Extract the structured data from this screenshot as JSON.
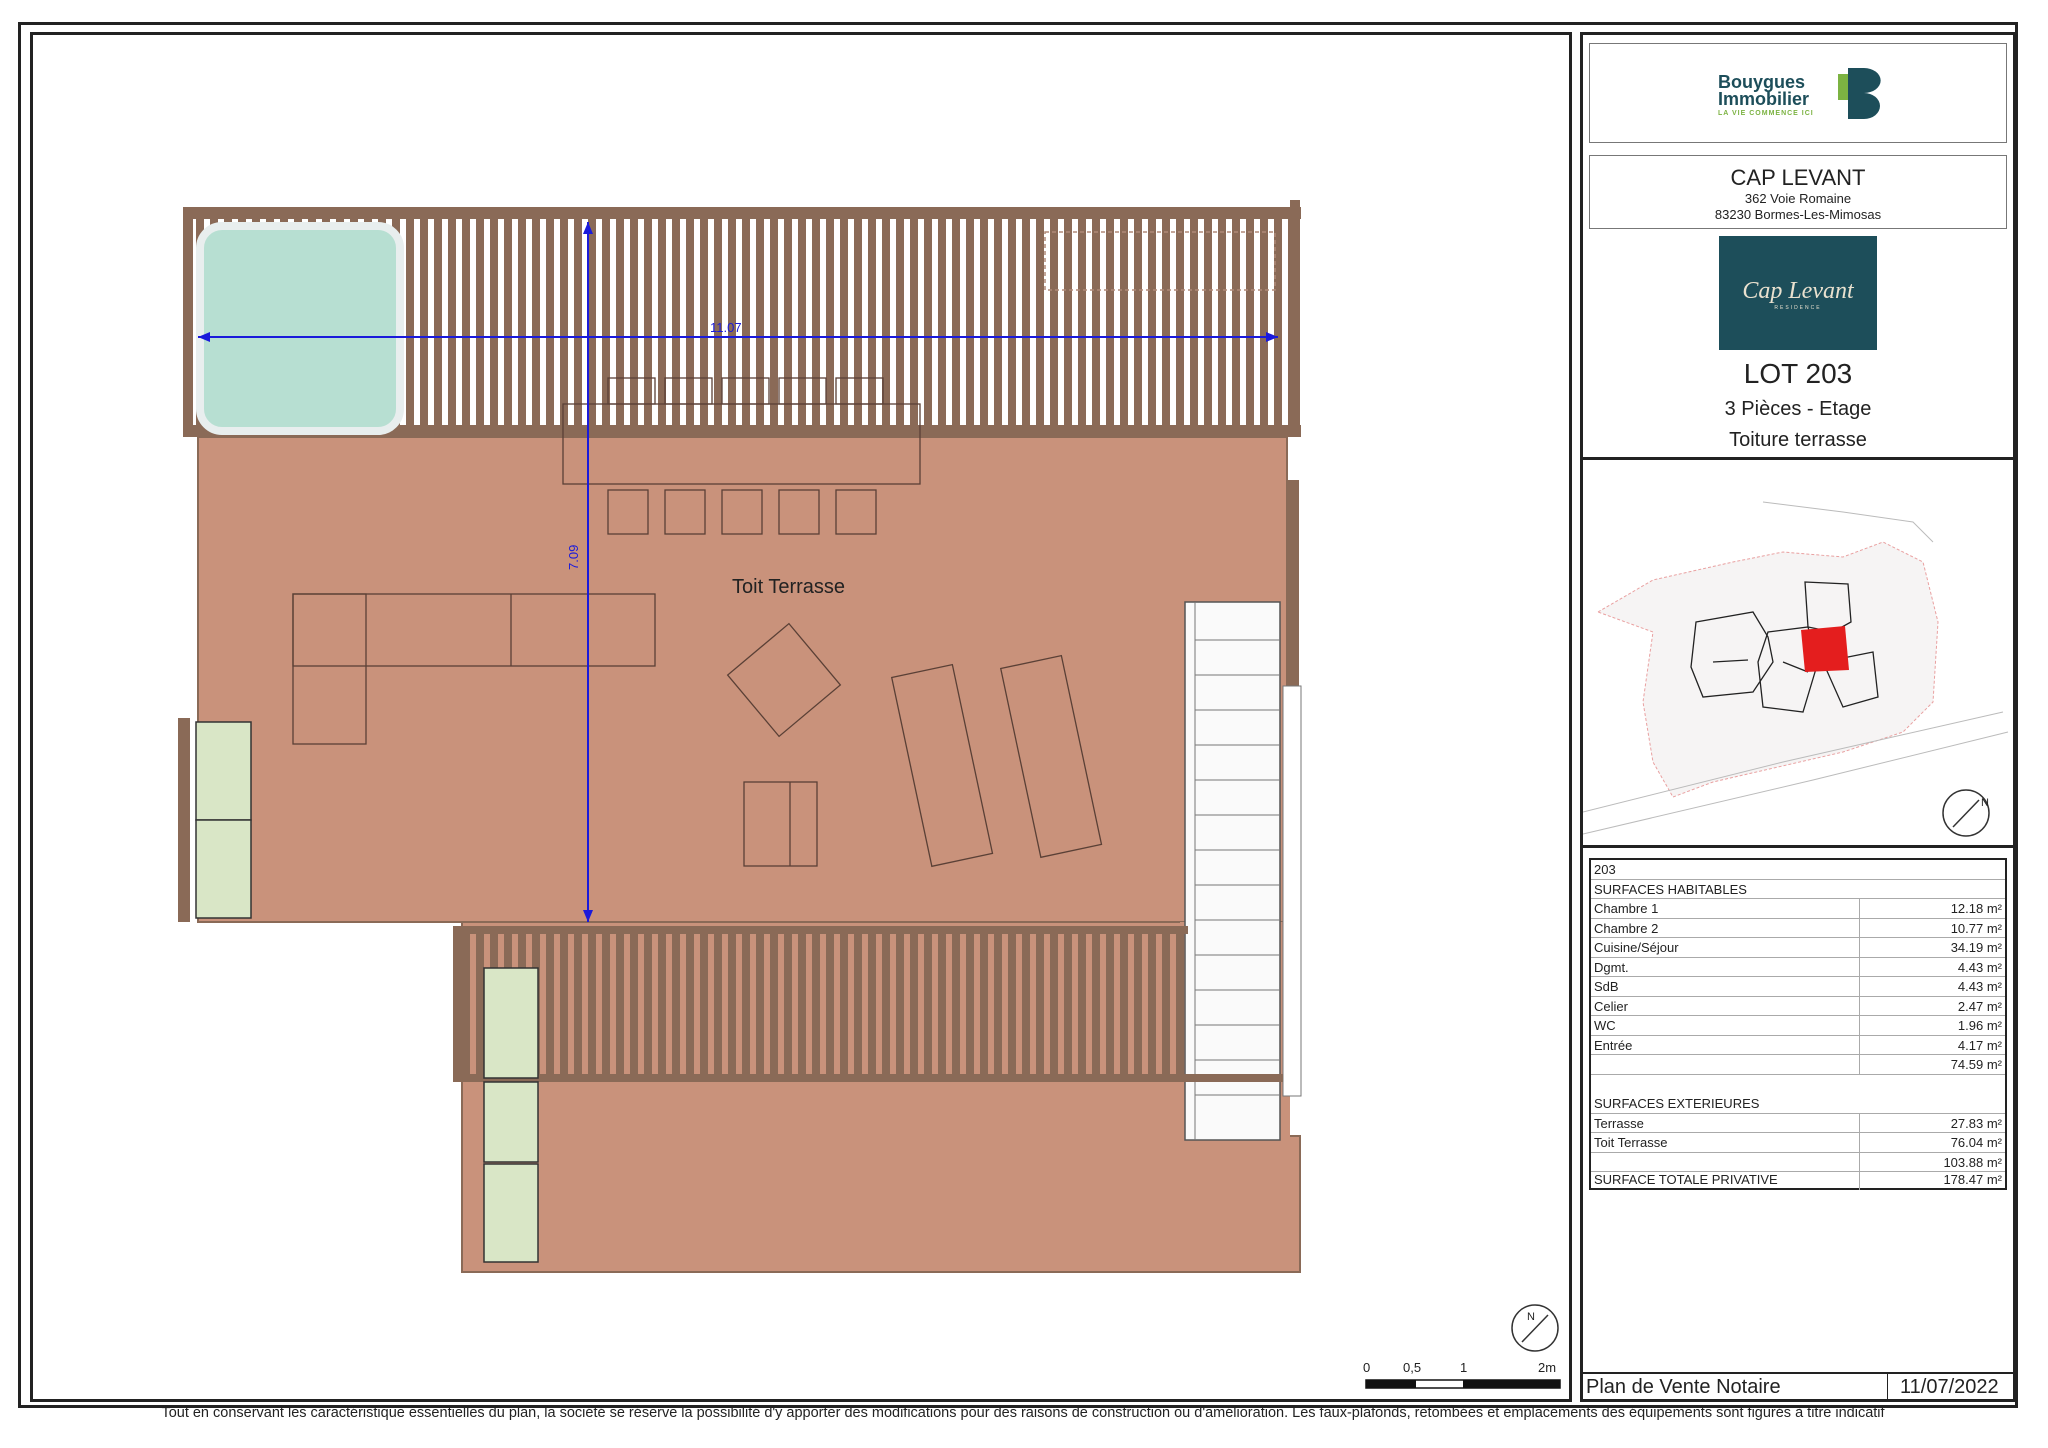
{
  "brand": {
    "name_line1": "Bouygues",
    "name_line2": "Immobilier",
    "tagline": "LA VIE COMMENCE ICI",
    "color_dark": "#1d4e5a",
    "color_green": "#7cb342"
  },
  "project": {
    "name": "CAP LEVANT",
    "address_line1": "362 Voie Romaine",
    "address_line2": "83230 Bormes-Les-Mimosas",
    "logo_text": "Cap Levant",
    "logo_subtext": "RESIDENCE"
  },
  "lot": {
    "title": "LOT 203",
    "type": "3 Pièces  - Etage",
    "level": "Toiture terrasse"
  },
  "plan": {
    "room_label": "Toit Terrasse",
    "dim_horizontal": "11.07",
    "dim_vertical": "7.09",
    "scale_labels": [
      "0",
      "0,5",
      "1",
      "2m"
    ],
    "north_label": "N",
    "colors": {
      "floor": "#c9927b",
      "pergola": "#8a6a57",
      "pool": "#b7dfd2",
      "planter": "#d9e6c6",
      "dimension": "#1a1adb"
    }
  },
  "site_plan": {
    "north_label": "N",
    "highlight_color": "#e41e1e"
  },
  "surfaces": {
    "lot_number": "203",
    "habitable_title": "SURFACES HABITABLES",
    "habitable": [
      {
        "label": "Chambre 1",
        "value": "12.18 m²"
      },
      {
        "label": "Chambre 2",
        "value": "10.77 m²"
      },
      {
        "label": "Cuisine/Séjour",
        "value": "34.19 m²"
      },
      {
        "label": "Dgmt.",
        "value": "4.43 m²"
      },
      {
        "label": "SdB",
        "value": "4.43 m²"
      },
      {
        "label": "Celier",
        "value": "2.47 m²"
      },
      {
        "label": "WC",
        "value": "1.96 m²"
      },
      {
        "label": "Entrée",
        "value": "4.17 m²"
      }
    ],
    "habitable_total": "74.59 m²",
    "exterior_title": "SURFACES EXTERIEURES",
    "exterior": [
      {
        "label": "Terrasse",
        "value": "27.83 m²"
      },
      {
        "label": "Toit Terrasse",
        "value": "76.04 m²"
      }
    ],
    "exterior_total": "103.88 m²",
    "total_label": "SURFACE TOTALE PRIVATIVE",
    "total_value": "178.47 m²"
  },
  "footer": {
    "doc_title": "Plan de Vente Notaire",
    "date": "11/07/2022",
    "disclaimer": "Tout en conservant les caractéristique essentielles du plan, la société se réserve la possibilité d'y apporter des modifications pour des raisons de construction ou d'amélioration. Les faux-plafonds, retombées et emplacements des équipements sont figurés à titre indicatif"
  }
}
